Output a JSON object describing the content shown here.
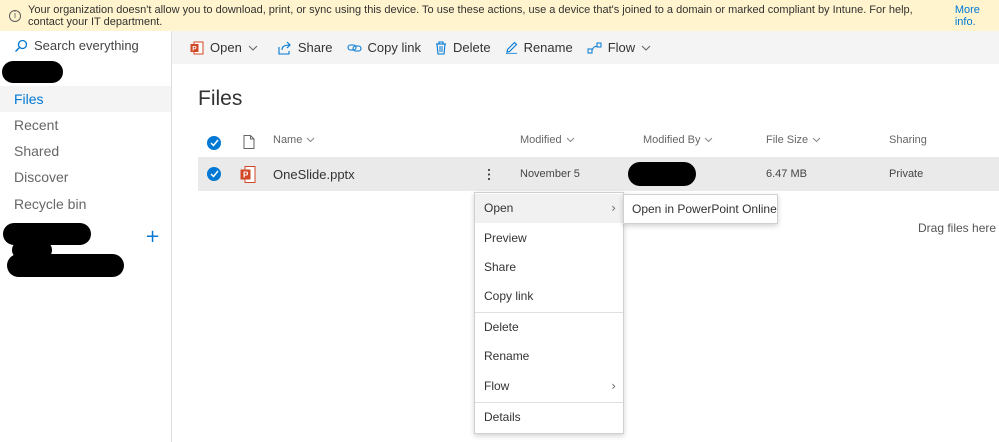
{
  "banner": {
    "message": "Your organization doesn't allow you to download, print, or sync using this device. To use these actions, use a device that's joined to a domain or marked compliant by Intune. For help, contact your IT department.",
    "link": "More info."
  },
  "sidebar": {
    "search_placeholder": "Search everything",
    "items": [
      {
        "label": "Files",
        "active": true
      },
      {
        "label": "Recent"
      },
      {
        "label": "Shared"
      },
      {
        "label": "Discover"
      },
      {
        "label": "Recycle bin"
      }
    ],
    "add_icon": "+"
  },
  "commandbar": {
    "open": "Open",
    "share": "Share",
    "copy_link": "Copy link",
    "delete": "Delete",
    "rename": "Rename",
    "flow": "Flow"
  },
  "page_title": "Files",
  "columns": {
    "name": "Name",
    "modified": "Modified",
    "modified_by": "Modified By",
    "file_size": "File Size",
    "sharing": "Sharing"
  },
  "rows": [
    {
      "name": "OneSlide.pptx",
      "modified": "November 5",
      "file_size": "6.47 MB",
      "sharing": "Private"
    }
  ],
  "context_menu": {
    "items": [
      "Open",
      "Preview",
      "Share",
      "Copy link",
      "Delete",
      "Rename",
      "Flow",
      "Details"
    ]
  },
  "submenu": {
    "item": "Open in PowerPoint Online"
  },
  "drag_hint": "Drag files here t",
  "colors": {
    "accent": "#0078d4",
    "banner_bg": "#fff4ce",
    "ppt_red": "#d24726"
  }
}
